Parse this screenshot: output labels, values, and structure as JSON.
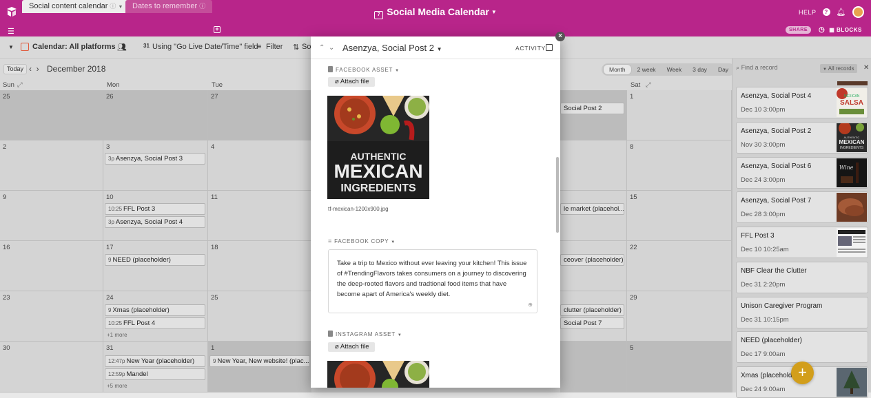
{
  "app": {
    "title": "Social Media Calendar",
    "help": "HELP",
    "share": "SHARE",
    "blocks": "BLOCKS"
  },
  "tabs": [
    {
      "label": "Social content calendar"
    },
    {
      "label": "Dates to remember"
    }
  ],
  "toolbar": {
    "view": "Calendar: All platforms",
    "date_field": "Using \"Go Live Date/Time\" field",
    "filter": "Filter",
    "sort": "So"
  },
  "calendar": {
    "today": "Today",
    "month": "December 2018",
    "views": [
      "Month",
      "2 week",
      "Week",
      "3 day",
      "Day"
    ],
    "active_view": "Month",
    "daynames": [
      "Sun",
      "Mon",
      "Tue",
      "Sat"
    ],
    "dates": [
      [
        "25",
        "26",
        "27",
        "1"
      ],
      [
        "2",
        "3",
        "4",
        "8"
      ],
      [
        "9",
        "10",
        "11",
        "15"
      ],
      [
        "16",
        "17",
        "18",
        "22"
      ],
      [
        "23",
        "24",
        "25",
        "29"
      ],
      [
        "30",
        "31",
        "1",
        "5"
      ]
    ],
    "events": {
      "w0_sat_left": "Social Post 2",
      "w1_mon": {
        "time": "3p",
        "label": "Asenzya, Social Post 3"
      },
      "w2_mon_1": {
        "time": "10:25",
        "label": "FFL Post 3"
      },
      "w2_mon_2": {
        "time": "3p",
        "label": "Asenzya, Social Post 4"
      },
      "w2_fri": "le market (placehol...",
      "w3_mon": {
        "time": "9",
        "label": "NEED (placeholder)"
      },
      "w3_fri": "ceover (placeholder)",
      "w4_mon_1": {
        "time": "9",
        "label": "Xmas (placeholder)"
      },
      "w4_mon_2": {
        "time": "10:25",
        "label": "FFL Post 4"
      },
      "w4_mon_more": "+1 more",
      "w4_fri_1": "clutter (placeholder)",
      "w4_fri_2": "Social Post 7",
      "w5_mon_1": {
        "time": "12:47p",
        "label": "New Year (placeholder)"
      },
      "w5_mon_2": {
        "time": "12:59p",
        "label": "Mandel"
      },
      "w5_mon_more": "+5 more",
      "w5_tue": {
        "time": "9",
        "label": "New Year, New website! (plac..."
      }
    }
  },
  "sidebar": {
    "search_placeholder": "Find a record",
    "filter": "All records",
    "records": [
      {
        "title": "Asenzya, Social Post 4",
        "date": "Dec 10 3:00pm",
        "thumb": "salsa"
      },
      {
        "title": "Asenzya, Social Post 2",
        "date": "Nov 30 3:00pm",
        "thumb": "mexican"
      },
      {
        "title": "Asenzya, Social Post 6",
        "date": "Dec 24 3:00pm",
        "thumb": "wine"
      },
      {
        "title": "Asenzya, Social Post 7",
        "date": "Dec 28 3:00pm",
        "thumb": "meat"
      },
      {
        "title": "FFL Post 3",
        "date": "Dec 10 10:25am",
        "thumb": "newspaper"
      },
      {
        "title": "NBF Clear the Clutter",
        "date": "Dec 31 2:20pm",
        "thumb": ""
      },
      {
        "title": "Unison Caregiver Program",
        "date": "Dec 31 10:15pm",
        "thumb": ""
      },
      {
        "title": "NEED (placeholder)",
        "date": "Dec 17 9:00am",
        "thumb": ""
      },
      {
        "title": "Xmas (placeholder)",
        "date": "Dec 24 9:00am",
        "thumb": "tree"
      }
    ]
  },
  "modal": {
    "title": "Asenzya, Social Post 2",
    "activity": "ACTIVITY",
    "facebook_asset_label": "FACEBOOK ASSET",
    "attach_label": "Attach file",
    "image_text": [
      "AUTHENTIC",
      "MEXICAN",
      "INGREDIENTS"
    ],
    "filename": "tf-mexican-1200x900.jpg",
    "facebook_copy_label": "FACEBOOK COPY",
    "facebook_copy": "Take a trip to Mexico without ever leaving your kitchen! This issue of #TrendingFlavors takes consumers on a journey to discovering the deep-rooted flavors and tradtional food items that have become apart of America's weekly diet.",
    "instagram_asset_label": "INSTAGRAM ASSET"
  },
  "colors": {
    "brand": "#b8258a",
    "fab": "#d29e1b"
  }
}
